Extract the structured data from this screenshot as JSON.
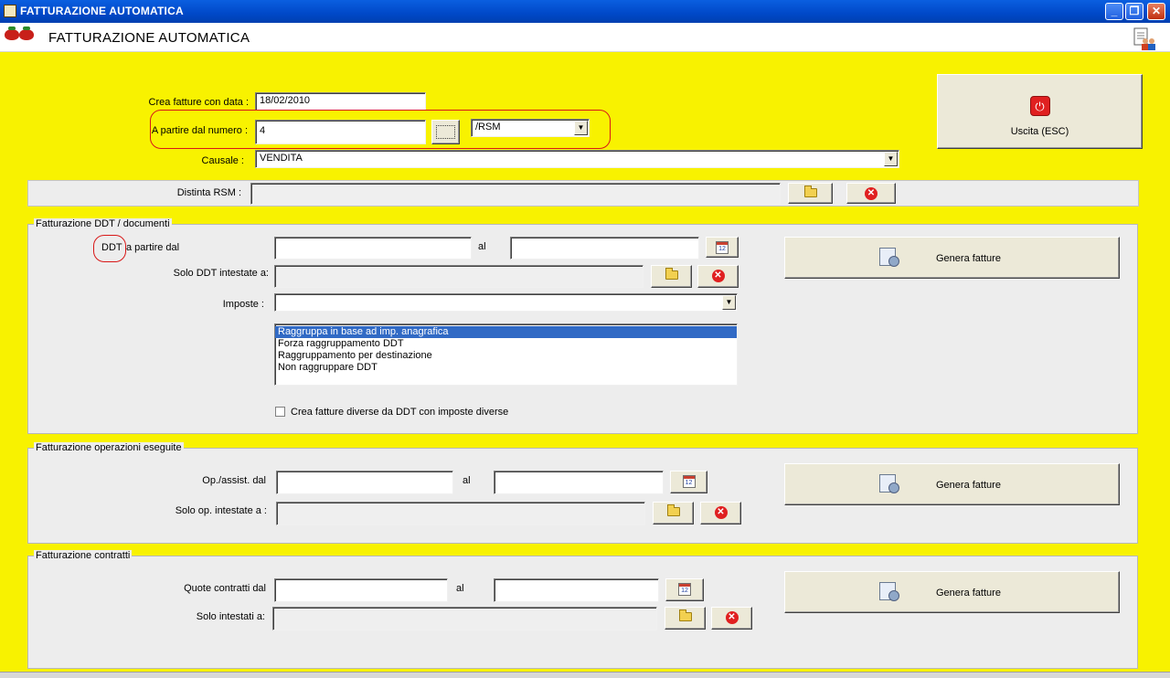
{
  "window": {
    "title": "FATTURAZIONE AUTOMATICA",
    "minimize": "_",
    "restore": "❐",
    "close": "✕"
  },
  "header": {
    "title": "FATTURAZIONE AUTOMATICA"
  },
  "top": {
    "data_label": "Crea fatture con data :",
    "data_value": "18/02/2010",
    "numero_label": "A partire dal numero :",
    "numero_value": "4",
    "serie_value": "/RSM",
    "causale_label": "Causale :",
    "causale_value": "VENDITA",
    "exit_label": "Uscita (ESC)",
    "exit_icon": "power-icon"
  },
  "distinta": {
    "label": "Distinta RSM :",
    "value": ""
  },
  "ddt": {
    "group_label": "Fatturazione DDT / documenti",
    "ddt_word": "DDT",
    "from_label": "a partire dal",
    "from_value": "",
    "al_label": "al",
    "to_value": "",
    "cal_text": "12",
    "solo_label": "Solo DDT intestate a:",
    "solo_value": "",
    "imposte_label": "Imposte :",
    "imposte_value": "",
    "options": [
      "Raggruppa in base ad imp. anagrafica",
      "Forza raggruppamento DDT",
      "Raggruppamento per destinazione",
      "Non raggruppare DDT"
    ],
    "selected_option": 0,
    "checkbox_label": "Crea fatture diverse da DDT con imposte diverse",
    "checkbox_checked": false,
    "genera_label": "Genera fatture"
  },
  "operazioni": {
    "group_label": "Fatturazione operazioni eseguite",
    "from_label": "Op./assist. dal",
    "from_value": "",
    "al_label": "al",
    "to_value": "",
    "cal_text": "12",
    "solo_label": "Solo op. intestate a :",
    "solo_value": "",
    "genera_label": "Genera fatture"
  },
  "contratti": {
    "group_label": "Fatturazione contratti",
    "from_label": "Quote contratti dal",
    "from_value": "",
    "al_label": "al",
    "to_value": "",
    "cal_text": "12",
    "solo_label": "Solo intestati a:",
    "solo_value": "",
    "genera_label": "Genera fatture"
  },
  "colors": {
    "background": "#f8f200",
    "titlebar": "#0048c8",
    "highlight": "#d81818",
    "selection": "#316ac5"
  }
}
